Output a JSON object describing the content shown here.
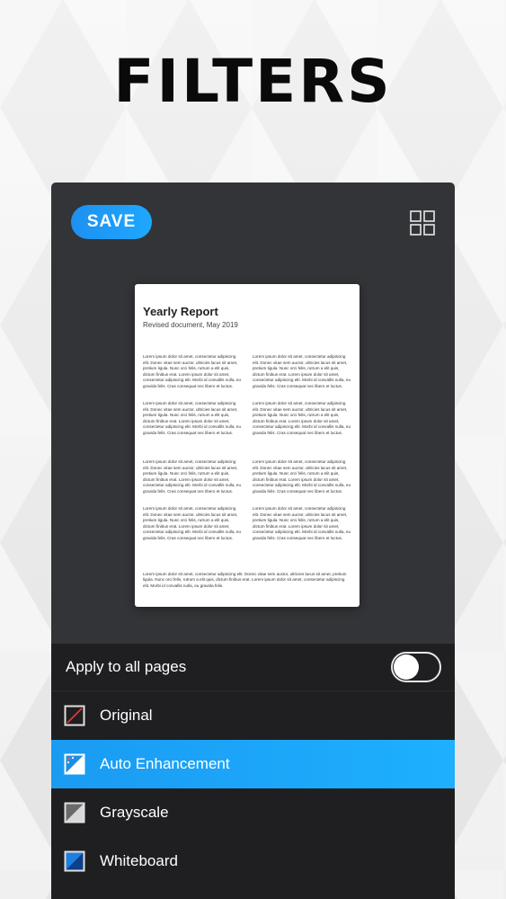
{
  "headline": "FILTERS",
  "toolbar": {
    "save_label": "SAVE",
    "grid_icon": "grid-view-icon"
  },
  "document": {
    "title": "Yearly Report",
    "subtitle": "Revised document, May 2019",
    "paragraphs": [
      "Lorem ipsum dolor sit amet, consectetur adipiscing elit. Donec vitae sem auctor, ultricies lacus sit amet, pretium ligula. Nunc orci felis, rutrum a elit quis, dictum finibus erat. Lorem ipsum dolor sit amet, consectetur adipiscing elit. Morbi id convallis nulla, eu gravida felis. Cras consequat nec libero et luctus.",
      "Lorem ipsum dolor sit amet, consectetur adipiscing elit. Donec vitae sem auctor, ultricies lacus sit amet, pretium ligula. Nunc orci felis, rutrum a elit quis, dictum finibus erat. Lorem ipsum dolor sit amet, consectetur adipiscing elit. Morbi id convallis nulla, eu gravida felis. Cras consequat nec libero et luctus.",
      "Lorem ipsum dolor sit amet, consectetur adipiscing elit. Donec vitae sem auctor, ultricies lacus sit amet, pretium ligula. Nunc orci felis, rutrum a elit quis, dictum finibus erat. Lorem ipsum dolor sit amet, consectetur adipiscing elit. Morbi id convallis nulla, eu gravida felis. Cras consequat nec libero et luctus.",
      "Lorem ipsum dolor sit amet, consectetur adipiscing elit. Donec vitae sem auctor, ultricies lacus sit amet, pretium ligula. Nunc orci felis, rutrum a elit quis, dictum finibus erat. Lorem ipsum dolor sit amet, consectetur adipiscing elit. Morbi id convallis nulla, eu gravida felis. Cras consequat nec libero et luctus.",
      "Lorem ipsum dolor sit amet, consectetur adipiscing elit. Donec vitae sem auctor, ultricies lacus sit amet, pretium ligula. Nunc orci felis, rutrum a elit quis, dictum finibus erat. Lorem ipsum dolor sit amet, consectetur adipiscing elit. Morbi id convallis nulla, eu gravida felis. Cras consequat nec libero et luctus.",
      "Lorem ipsum dolor sit amet, consectetur adipiscing elit. Donec vitae sem auctor, ultricies lacus sit amet, pretium ligula. Nunc orci felis, rutrum a elit quis, dictum finibus erat. Lorem ipsum dolor sit amet, consectetur adipiscing elit. Morbi id convallis nulla, eu gravida felis. Cras consequat nec libero et luctus.",
      "Lorem ipsum dolor sit amet, consectetur adipiscing elit. Donec vitae sem auctor, ultricies lacus sit amet, pretium ligula. Nunc orci felis, rutrum a elit quis, dictum finibus erat. Lorem ipsum dolor sit amet, consectetur adipiscing elit. Morbi id convallis nulla, eu gravida felis. Cras consequat nec libero et luctus.",
      "Lorem ipsum dolor sit amet, consectetur adipiscing elit. Donec vitae sem auctor, ultricies lacus sit amet, pretium ligula. Nunc orci felis, rutrum a elit quis, dictum finibus erat. Lorem ipsum dolor sit amet, consectetur adipiscing elit. Morbi id convallis nulla, eu gravida felis. Cras consequat nec libero et luctus."
    ],
    "footer_paragraph": "Lorem ipsum dolor sit amet, consectetur adipiscing elit. Donec vitae sem auctor, ultricies lacus sit amet, pretium ligula. Nunc orci felis, rutrum a elit quis, dictum finibus erat. Lorem ipsum dolor sit amet, consectetur adipiscing elit. Morbi id convallis nulla, eu gravida felis."
  },
  "apply_all": {
    "label": "Apply to all pages",
    "enabled": false
  },
  "filters": [
    {
      "label": "Original",
      "icon": "original-filter-icon",
      "selected": false
    },
    {
      "label": "Auto Enhancement",
      "icon": "auto-enhancement-filter-icon",
      "selected": true
    },
    {
      "label": "Grayscale",
      "icon": "grayscale-filter-icon",
      "selected": false
    },
    {
      "label": "Whiteboard",
      "icon": "whiteboard-filter-icon",
      "selected": false
    }
  ],
  "colors": {
    "accent": "#1ea8ff",
    "panel": "#1f1f21",
    "editor_bg": "#333437"
  }
}
